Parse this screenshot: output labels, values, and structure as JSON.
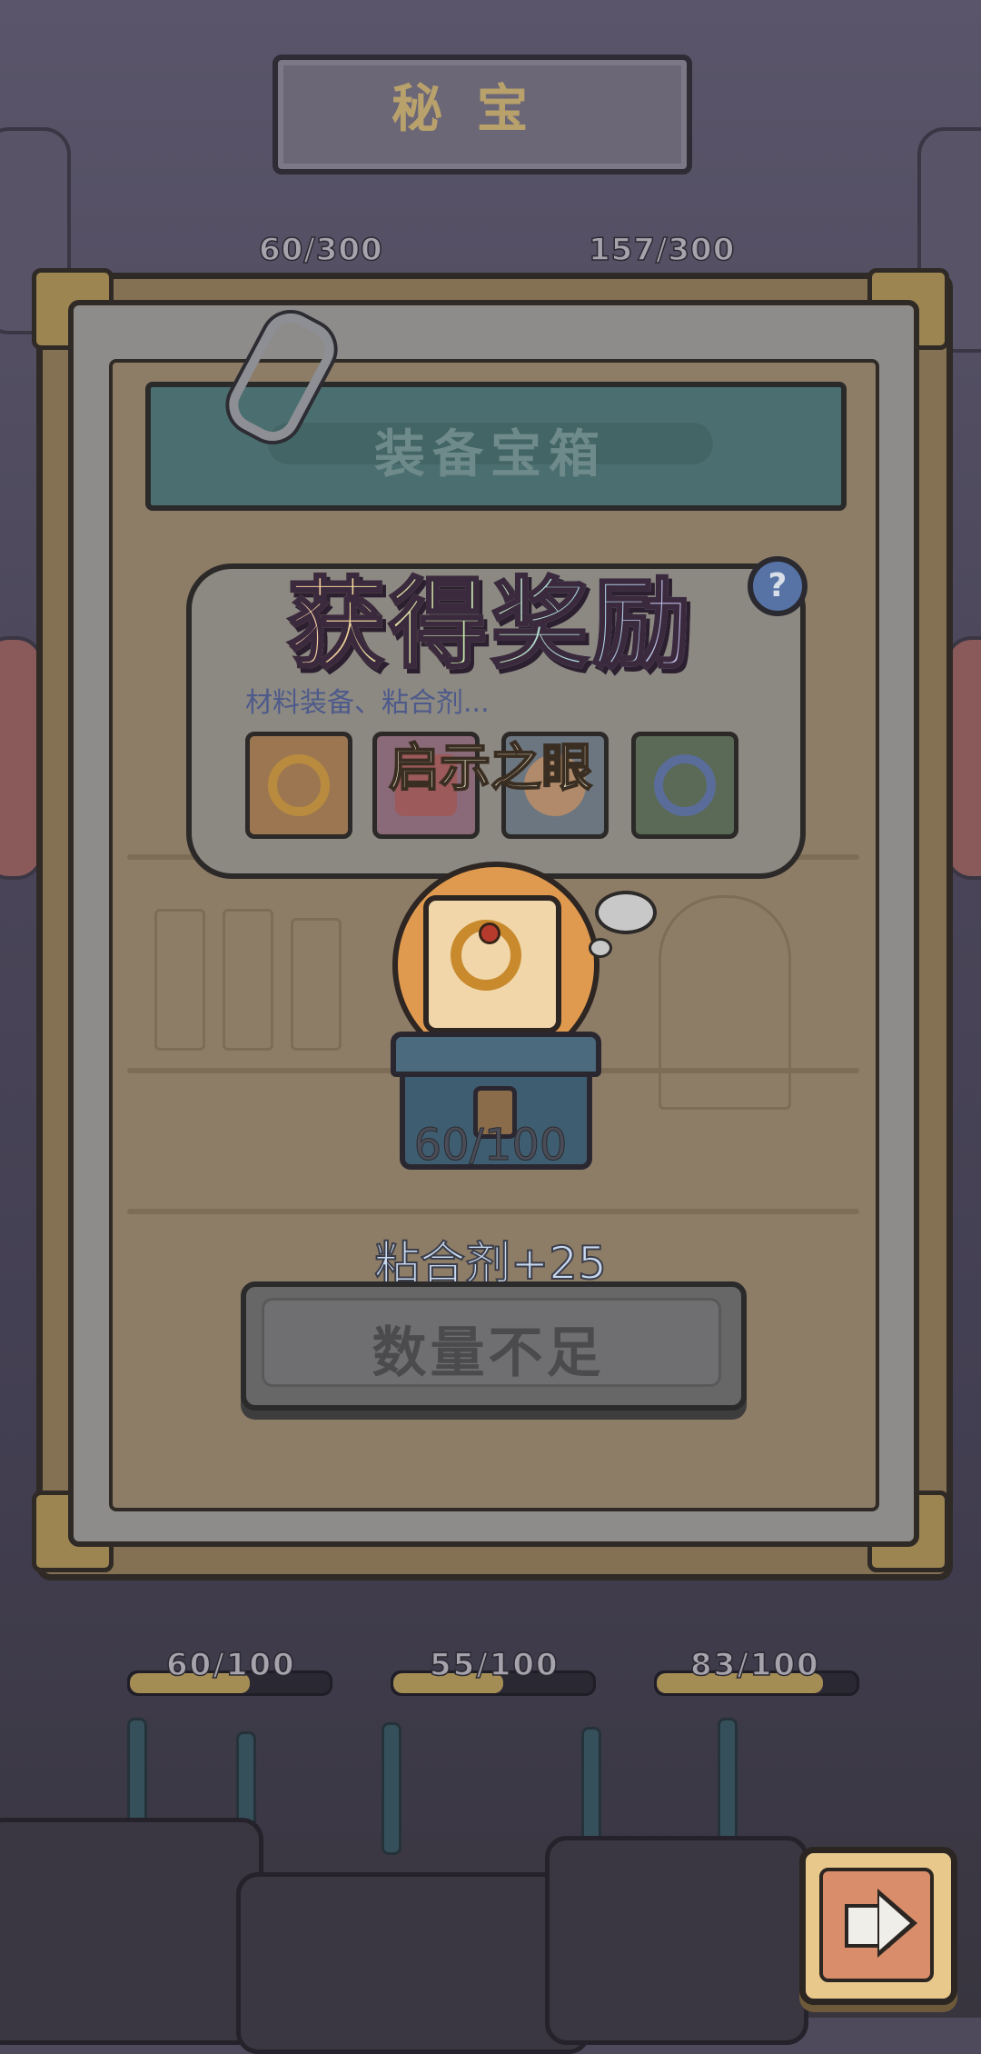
{
  "header": {
    "title": "秘宝"
  },
  "top_counters": [
    "60/300",
    "157/300"
  ],
  "panel": {
    "title": "装备宝箱"
  },
  "reward_popup": {
    "heading": "获得奖励",
    "item_name": "启示之眼",
    "description": "材料装备、粘合剂..."
  },
  "chest": {
    "progress": "60/100",
    "progress_value": 60,
    "progress_max": 100
  },
  "bonus": "粘合剂+25",
  "action_button": {
    "label": "数量不足"
  },
  "bottom_counters": [
    {
      "label": "60/100",
      "value": 60,
      "max": 100
    },
    {
      "label": "55/100",
      "value": 55,
      "max": 100
    },
    {
      "label": "83/100",
      "value": 83,
      "max": 100
    }
  ],
  "colors": {
    "accent_orange": "#e09a4f",
    "bonus_blue": "#c8d8ef"
  },
  "icons": [
    "help-icon",
    "ring-icon",
    "next-arrow-icon",
    "paper-clip-icon"
  ]
}
